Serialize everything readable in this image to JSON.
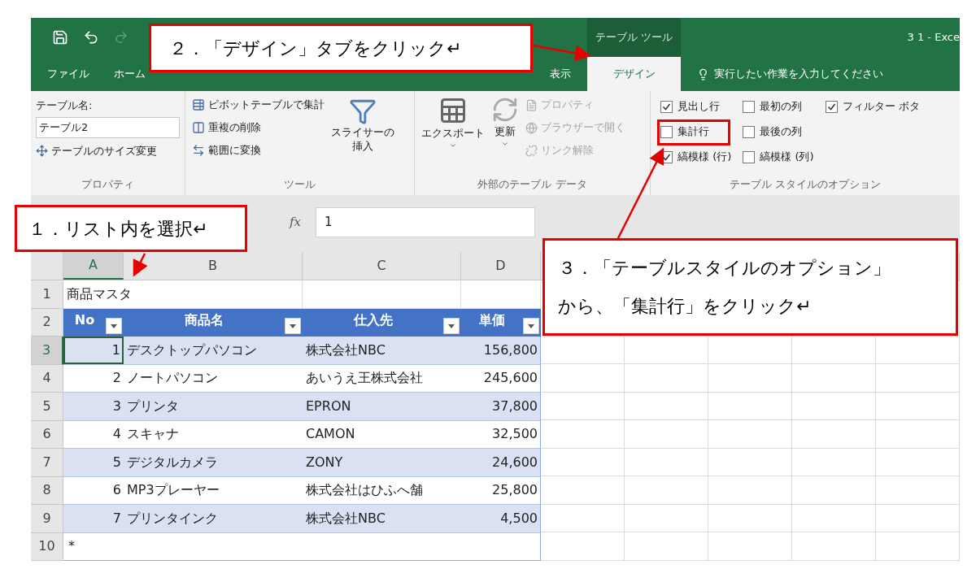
{
  "window": {
    "title": "3 1 - Exce",
    "contextual_group": "テーブル ツール"
  },
  "ribbon_tabs": [
    {
      "label": "ファイル",
      "selected": false
    },
    {
      "label": "ホーム",
      "selected": false
    },
    {
      "label": "表示",
      "selected": false
    },
    {
      "label": "デザイン",
      "selected": true
    }
  ],
  "tell_me": {
    "placeholder": "実行したい作業を入力してください"
  },
  "properties_group": {
    "title": "プロパティ",
    "table_name_label": "テーブル名:",
    "table_name": "テーブル2",
    "resize_button": "テーブルのサイズ変更"
  },
  "tools_group": {
    "title": "ツール",
    "buttons": [
      "ピボットテーブルで集計",
      "重複の削除",
      "範囲に変換"
    ],
    "slicer_button": [
      "スライサーの",
      "挿入"
    ]
  },
  "external_group": {
    "title": "外部のテーブル データ",
    "export_button": "エクスポート",
    "refresh_button": "更新",
    "items": [
      {
        "label": "プロパティ",
        "disabled": true
      },
      {
        "label": "ブラウザーで開く",
        "disabled": true
      },
      {
        "label": "リンク解除",
        "disabled": true
      }
    ]
  },
  "style_options_group": {
    "title": "テーブル スタイルのオプション",
    "columns": [
      [
        {
          "label": "見出し行",
          "checked": true
        },
        {
          "label": "集計行",
          "checked": false
        },
        {
          "label": "縞模様 (行)",
          "checked": true
        }
      ],
      [
        {
          "label": "最初の列",
          "checked": false
        },
        {
          "label": "最後の列",
          "checked": false
        },
        {
          "label": "縞模様 (列)",
          "checked": false
        }
      ],
      [
        {
          "label": "フィルター ボタ",
          "checked": true
        }
      ]
    ]
  },
  "formula_bar": {
    "function_label": "fx",
    "value": "1"
  },
  "sheet": {
    "columns": [
      {
        "label": "A",
        "selected": true
      },
      {
        "label": "B",
        "selected": false
      },
      {
        "label": "C",
        "selected": false
      },
      {
        "label": "D",
        "selected": false
      }
    ],
    "row_headers": [
      {
        "label": "1",
        "selected": false
      },
      {
        "label": "2",
        "selected": false
      },
      {
        "label": "3",
        "selected": true
      },
      {
        "label": "4",
        "selected": false
      },
      {
        "label": "5",
        "selected": false
      },
      {
        "label": "6",
        "selected": false
      },
      {
        "label": "7",
        "selected": false
      },
      {
        "label": "8",
        "selected": false
      },
      {
        "label": "9",
        "selected": false
      },
      {
        "label": "10",
        "selected": false
      }
    ],
    "title_cell": "商品マスタ",
    "table_headers": [
      "No",
      "商品名",
      "仕入先",
      "単価"
    ],
    "table_rows": [
      {
        "no": "1",
        "name": "デスクトップパソコン",
        "supplier": "株式会社NBC",
        "price": "156,800"
      },
      {
        "no": "2",
        "name": "ノートパソコン",
        "supplier": "あいうえ王株式会社",
        "price": "245,600"
      },
      {
        "no": "3",
        "name": "プリンタ",
        "supplier": "EPRON",
        "price": "37,800"
      },
      {
        "no": "4",
        "name": "スキャナ",
        "supplier": "CAMON",
        "price": "32,500"
      },
      {
        "no": "5",
        "name": "デジタルカメラ",
        "supplier": "ZONY",
        "price": "24,600"
      },
      {
        "no": "6",
        "name": "MP3プレーヤー",
        "supplier": "株式会社はひふへ舗",
        "price": "25,800"
      },
      {
        "no": "7",
        "name": "プリンタインク",
        "supplier": "株式会社NBC",
        "price": "4,500"
      }
    ],
    "new_row_marker": "*"
  },
  "callouts": [
    {
      "lines": [
        "１．リスト内を選択↵"
      ]
    },
    {
      "lines": [
        "２．「デザイン」タブをクリック↵"
      ]
    },
    {
      "lines": [
        "３．「テーブルスタイルのオプション」",
        "から、「集計行」をクリック↵"
      ]
    }
  ]
}
